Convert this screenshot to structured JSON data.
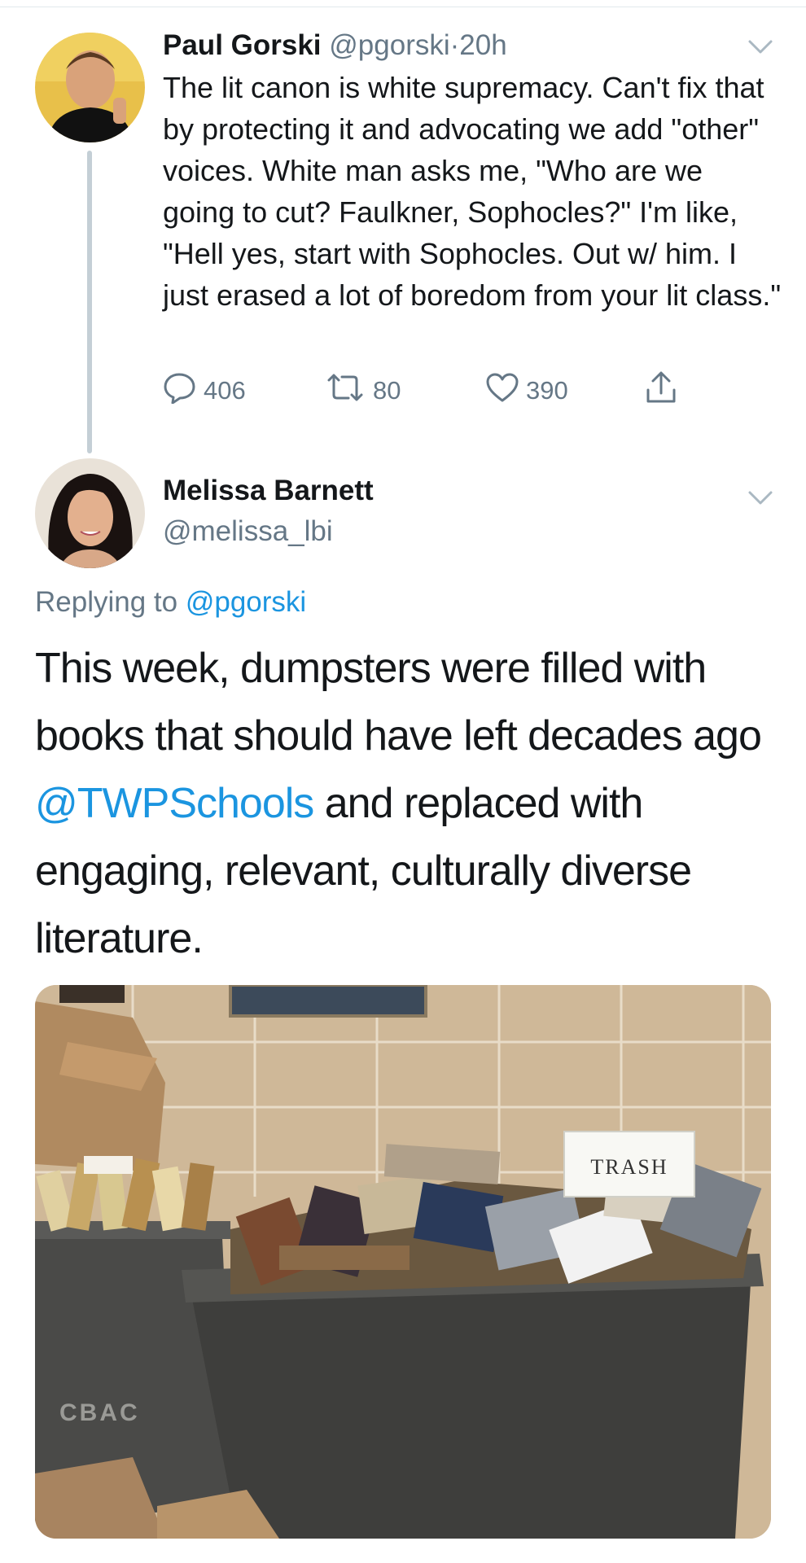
{
  "tweet1": {
    "author_name": "Paul Gorski",
    "handle": "@pgorski",
    "separator": "·",
    "time": "20h",
    "text": "The lit canon is white supremacy. Can't fix that by protecting it and advocating we add \"other\" voices. White man asks me, \"Who are we going to cut? Faulkner, Sophocles?\" I'm like, \"Hell yes, start with Sophocles. Out w/ him. I just erased a lot of boredom from your lit class.\"",
    "replies": "406",
    "retweets": "80",
    "likes": "390",
    "icons": {
      "reply": "reply-icon",
      "retweet": "retweet-icon",
      "like": "heart-icon",
      "share": "share-icon",
      "menu": "chevron-down-icon"
    }
  },
  "tweet2": {
    "author_name": "Melissa Barnett",
    "handle": "@melissa_lbi",
    "replying_prefix": "Replying to ",
    "replying_to": "@pgorski",
    "text_part1": "This week, dumpsters were filled with books that should have left decades ago ",
    "mention": "@TWPSchools",
    "text_part2": " and replaced with engaging, relevant, culturally diverse literature.",
    "photo_sign_text": "TRASH",
    "photo_bin_text": "CBAC"
  },
  "colors": {
    "text": "#14171a",
    "secondary": "#657786",
    "link": "#1b95e0",
    "thread_line": "#c4cfd6",
    "divider": "#e1e8ed"
  }
}
